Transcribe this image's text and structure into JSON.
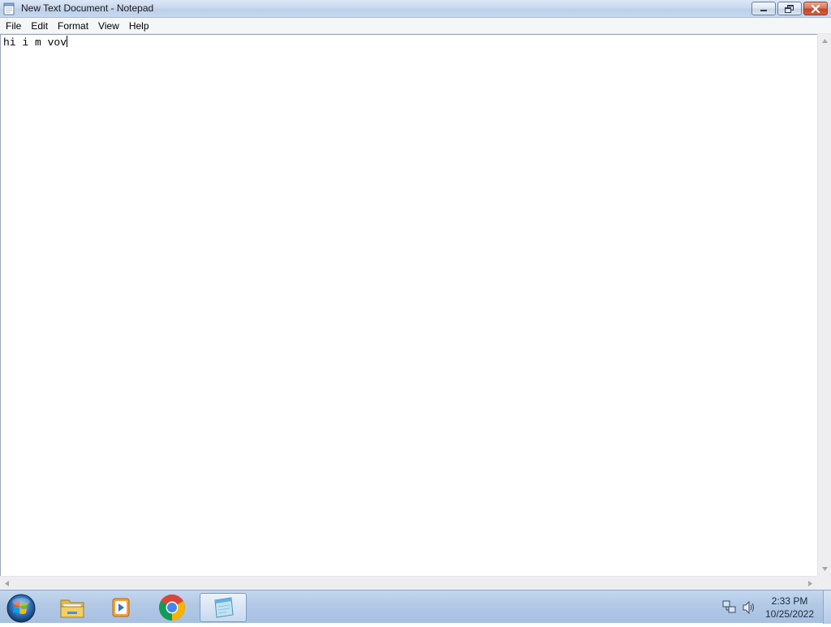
{
  "window": {
    "title": "New Text Document - Notepad"
  },
  "menu": {
    "items": [
      "File",
      "Edit",
      "Format",
      "View",
      "Help"
    ]
  },
  "editor": {
    "content": "hi i m vov"
  },
  "taskbar": {
    "pinned": [
      {
        "name": "Windows Explorer",
        "icon": "folder-icon"
      },
      {
        "name": "Windows Media Player",
        "icon": "media-player-icon"
      },
      {
        "name": "Google Chrome",
        "icon": "chrome-icon"
      },
      {
        "name": "Notepad",
        "icon": "notepad-icon",
        "active": true
      }
    ],
    "clock": {
      "time": "2:33 PM",
      "date": "10/25/2022"
    }
  },
  "colors": {
    "titlebar": "#c9daf0",
    "close_button": "#c7442a",
    "taskbar": "#b3cae6"
  }
}
